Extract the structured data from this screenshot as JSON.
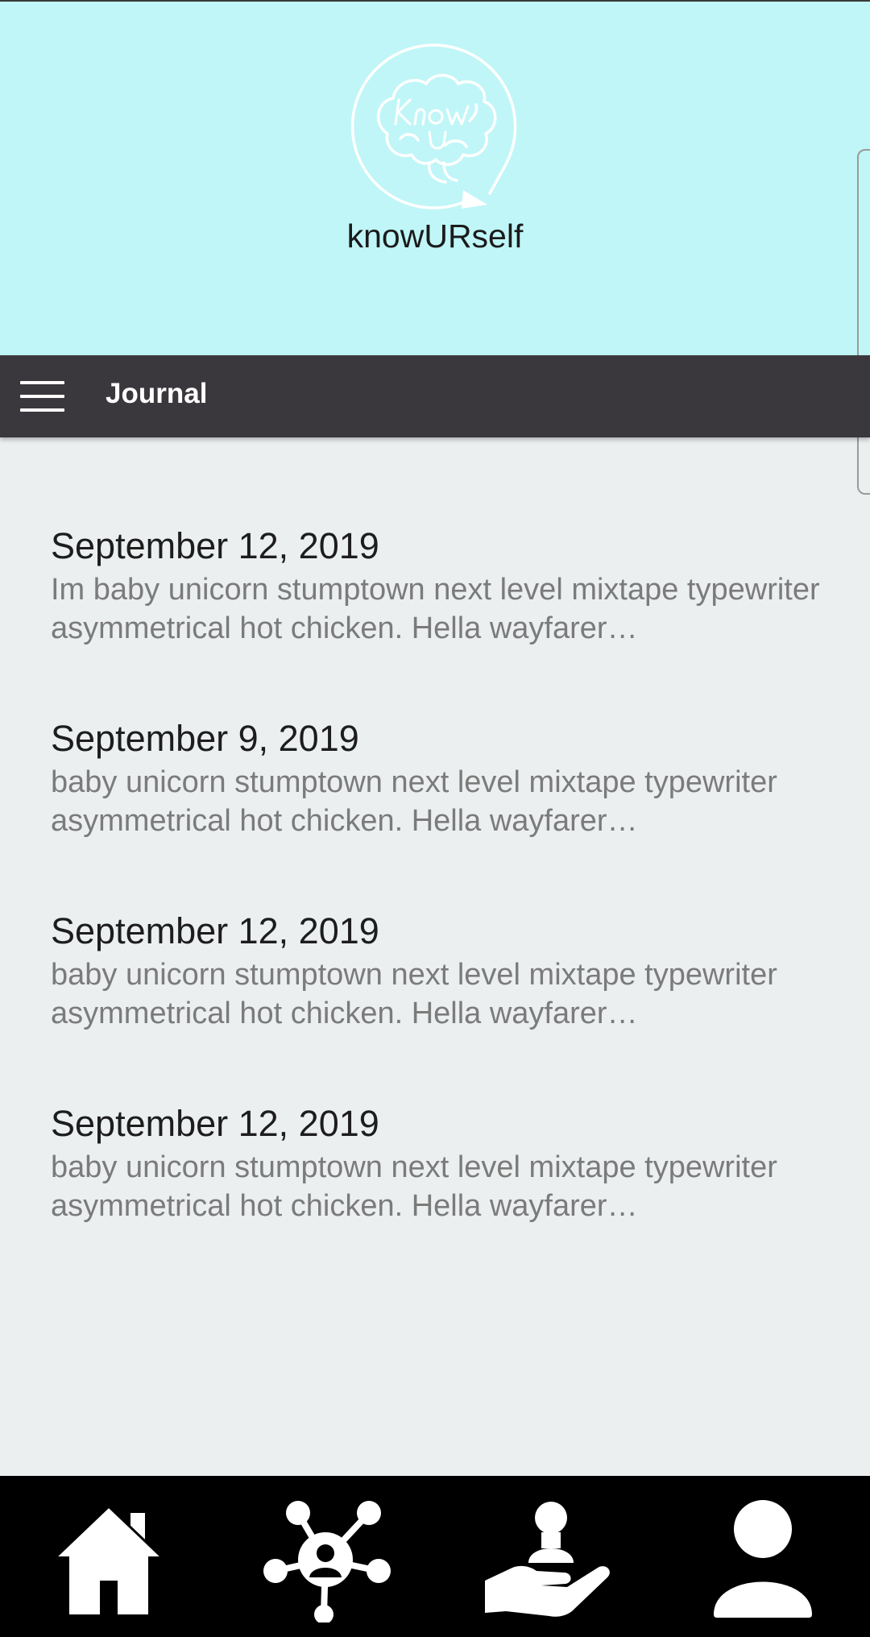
{
  "header": {
    "app_name": "knowURself",
    "logo_text": "Know U"
  },
  "toolbar": {
    "title": "Journal"
  },
  "entries": [
    {
      "date": "September 12, 2019",
      "preview": "Im baby unicorn stumptown next level mixtape typewriter asymmetrical hot chicken. Hella wayfarer…"
    },
    {
      "date": "September 9, 2019",
      "preview": "baby unicorn stumptown next level mixtape typewriter asymmetrical hot chicken. Hella wayfarer…"
    },
    {
      "date": "September 12, 2019",
      "preview": "baby unicorn stumptown next level mixtape typewriter asymmetrical hot chicken. Hella wayfarer…"
    },
    {
      "date": "September 12, 2019",
      "preview": "baby unicorn stumptown next level mixtape typewriter asymmetrical hot chicken. Hella wayfarer…"
    }
  ],
  "bottom_nav": {
    "items": [
      {
        "icon": "home-icon"
      },
      {
        "icon": "network-icon"
      },
      {
        "icon": "helping-hand-icon"
      },
      {
        "icon": "profile-icon"
      }
    ]
  },
  "colors": {
    "header_bg": "#C0F6F7",
    "toolbar_bg": "#3B383D",
    "content_bg": "#ECEFF0",
    "bottom_nav_bg": "#000000"
  }
}
